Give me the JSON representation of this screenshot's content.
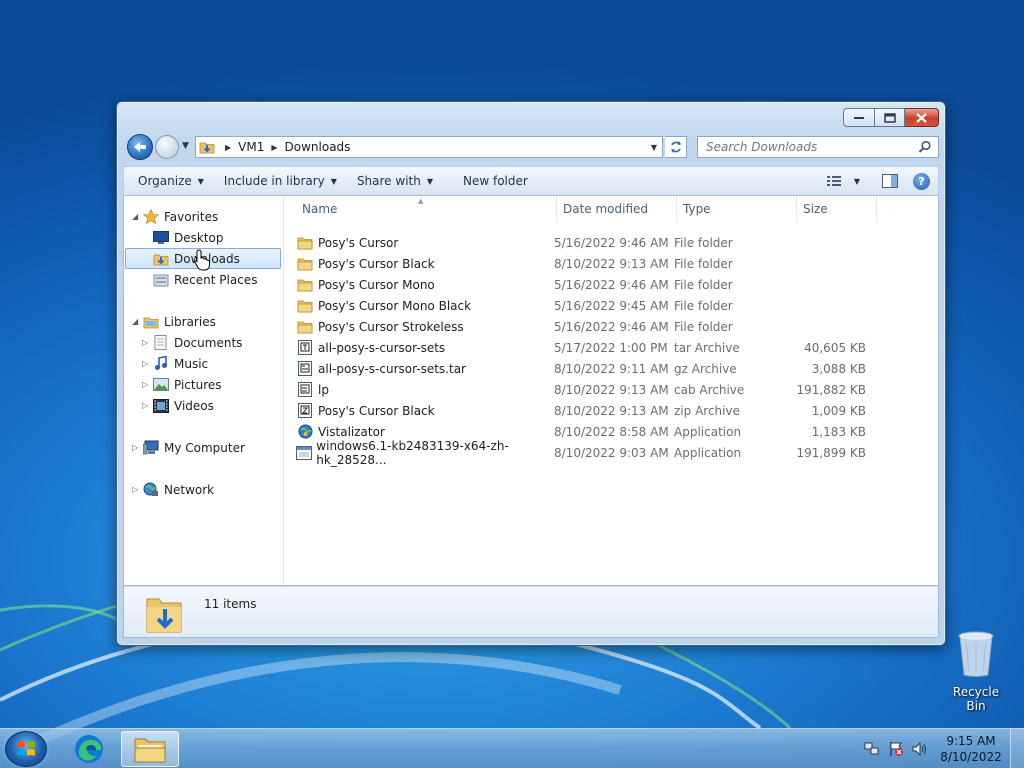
{
  "window": {
    "address": {
      "crumbs": [
        "VM1",
        "Downloads"
      ]
    },
    "search_placeholder": "Search Downloads",
    "toolbar": {
      "organize": "Organize",
      "include_in_library": "Include in library",
      "share_with": "Share with",
      "new_folder": "New folder"
    },
    "navpane": {
      "favorites": "Favorites",
      "desktop": "Desktop",
      "downloads": "Downloads",
      "recent_places": "Recent Places",
      "libraries": "Libraries",
      "documents": "Documents",
      "music": "Music",
      "pictures": "Pictures",
      "videos": "Videos",
      "my_computer": "My Computer",
      "network": "Network"
    },
    "columns": {
      "name": "Name",
      "date": "Date modified",
      "type": "Type",
      "size": "Size"
    },
    "files": [
      {
        "name": "Posy's Cursor",
        "date": "5/16/2022 9:46 AM",
        "type": "File folder",
        "size": "",
        "icon": "folder-icon"
      },
      {
        "name": "Posy's Cursor Black",
        "date": "8/10/2022 9:13 AM",
        "type": "File folder",
        "size": "",
        "icon": "folder-icon"
      },
      {
        "name": "Posy's Cursor Mono",
        "date": "5/16/2022 9:46 AM",
        "type": "File folder",
        "size": "",
        "icon": "folder-icon"
      },
      {
        "name": "Posy's Cursor Mono Black",
        "date": "5/16/2022 9:45 AM",
        "type": "File folder",
        "size": "",
        "icon": "folder-icon"
      },
      {
        "name": "Posy's Cursor Strokeless",
        "date": "5/16/2022 9:46 AM",
        "type": "File folder",
        "size": "",
        "icon": "folder-icon"
      },
      {
        "name": "all-posy-s-cursor-sets",
        "date": "5/17/2022 1:00 PM",
        "type": "tar Archive",
        "size": "40,605 KB",
        "icon": "tar-archive-icon"
      },
      {
        "name": "all-posy-s-cursor-sets.tar",
        "date": "8/10/2022 9:11 AM",
        "type": "gz Archive",
        "size": "3,088 KB",
        "icon": "gz-archive-icon"
      },
      {
        "name": "lp",
        "date": "8/10/2022 9:13 AM",
        "type": "cab Archive",
        "size": "191,882 KB",
        "icon": "cab-archive-icon"
      },
      {
        "name": "Posy's Cursor Black",
        "date": "8/10/2022 9:13 AM",
        "type": "zip Archive",
        "size": "1,009 KB",
        "icon": "zip-archive-icon"
      },
      {
        "name": "Vistalizator",
        "date": "8/10/2022 8:58 AM",
        "type": "Application",
        "size": "1,183 KB",
        "icon": "globe-app-icon"
      },
      {
        "name": "windows6.1-kb2483139-x64-zh-hk_28528...",
        "date": "8/10/2022 9:03 AM",
        "type": "Application",
        "size": "191,899 KB",
        "icon": "installer-app-icon"
      }
    ],
    "status": {
      "count": "11 items"
    }
  },
  "desktop": {
    "recycle_bin": "Recycle Bin"
  },
  "taskbar": {
    "time": "9:15 AM",
    "date": "8/10/2022"
  },
  "colors": {
    "accent": "#1c5fad",
    "selection": "#cfe5fb"
  }
}
